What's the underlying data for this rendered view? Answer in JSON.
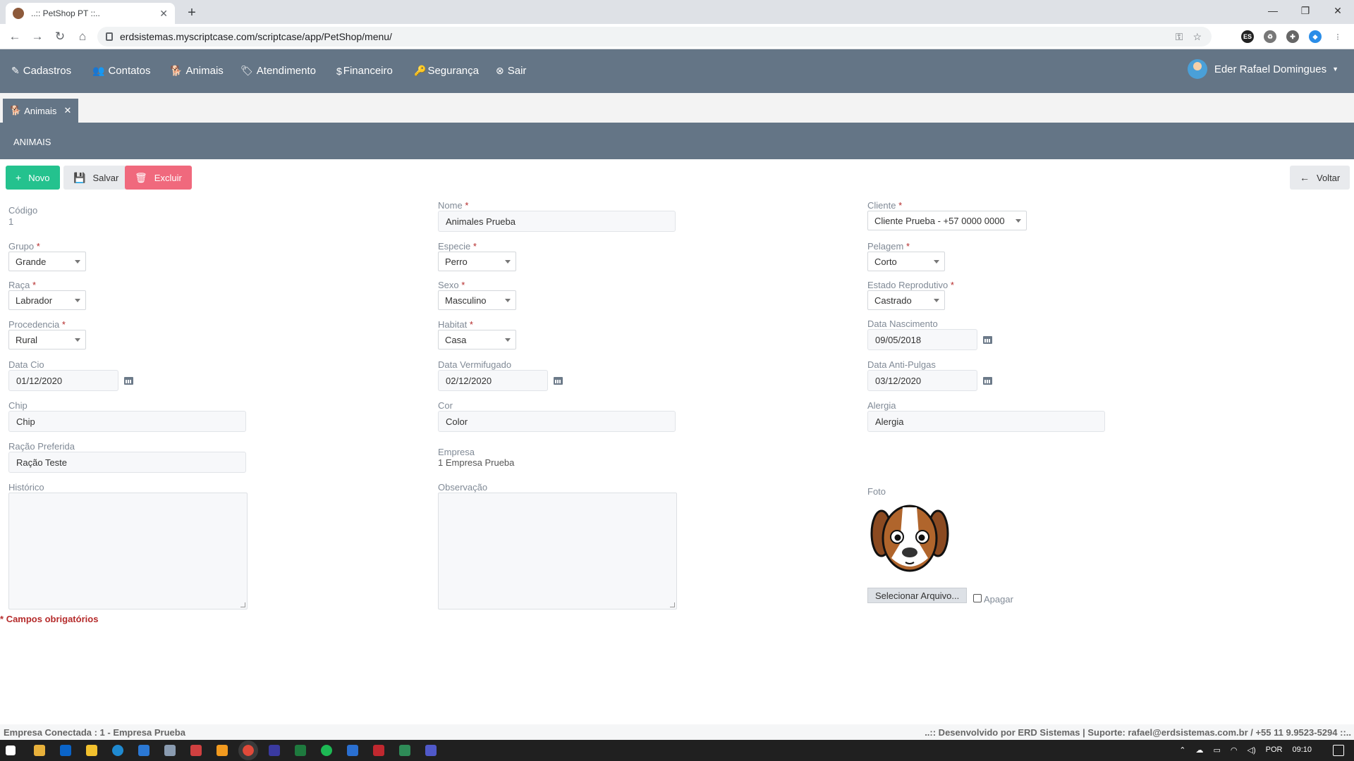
{
  "browser": {
    "tab_title": "..:: PetShop PT ::..",
    "url": "erdsistemas.myscriptcase.com/scriptcase/app/PetShop/menu/",
    "ext_label": "ES"
  },
  "menu": {
    "items": [
      {
        "label": "Cadastros",
        "icon": "edit-icon"
      },
      {
        "label": "Contatos",
        "icon": "users-icon"
      },
      {
        "label": "Animais",
        "icon": "dog-icon"
      },
      {
        "label": "Atendimento",
        "icon": "tags-icon"
      },
      {
        "label": "Financeiro",
        "icon": "dollar-icon"
      },
      {
        "label": "Segurança",
        "icon": "key-icon"
      },
      {
        "label": "Sair",
        "icon": "close-circle-icon"
      }
    ],
    "user_name": "Eder Rafael Domingues"
  },
  "app_tab": {
    "label": "Animais"
  },
  "page_title": "ANIMAIS",
  "actions": {
    "novo": "Novo",
    "salvar": "Salvar",
    "excluir": "Excluir",
    "voltar": "Voltar"
  },
  "form": {
    "codigo": {
      "label": "Código",
      "value": "1"
    },
    "nome": {
      "label": "Nome",
      "value": "Animales Prueba"
    },
    "cliente": {
      "label": "Cliente",
      "value": "Cliente Prueba - +57 0000 0000"
    },
    "grupo": {
      "label": "Grupo",
      "value": "Grande"
    },
    "especie": {
      "label": "Especie",
      "value": "Perro"
    },
    "pelagem": {
      "label": "Pelagem",
      "value": "Corto"
    },
    "raca": {
      "label": "Raça",
      "value": "Labrador"
    },
    "sexo": {
      "label": "Sexo",
      "value": "Masculino"
    },
    "estado_reprodutivo": {
      "label": "Estado Reprodutivo",
      "value": "Castrado"
    },
    "procedencia": {
      "label": "Procedencia",
      "value": "Rural"
    },
    "habitat": {
      "label": "Habitat",
      "value": "Casa"
    },
    "data_nascimento": {
      "label": "Data Nascimento",
      "value": "09/05/2018"
    },
    "data_cio": {
      "label": "Data Cio",
      "value": "01/12/2020"
    },
    "data_vermifugado": {
      "label": "Data Vermifugado",
      "value": "02/12/2020"
    },
    "data_anti_pulgas": {
      "label": "Data Anti-Pulgas",
      "value": "03/12/2020"
    },
    "chip": {
      "label": "Chip",
      "value": "Chip"
    },
    "cor": {
      "label": "Cor",
      "value": "Color"
    },
    "alergia": {
      "label": "Alergia",
      "value": "Alergia"
    },
    "racao_preferida": {
      "label": "Ração Preferida",
      "value": "Ração Teste"
    },
    "empresa": {
      "label": "Empresa",
      "value": "1 Empresa Prueba"
    },
    "historico": {
      "label": "Histórico",
      "value": ""
    },
    "observacao": {
      "label": "Observação",
      "value": ""
    },
    "foto": {
      "label": "Foto",
      "file_button": "Selecionar Arquivo...",
      "apagar_label": "Apagar"
    },
    "required_star": "*",
    "required_note": "Campos obrigatórios"
  },
  "footer": {
    "left": "Empresa Conectada : 1 - Empresa Prueba",
    "right": "..:: Desenvolvido por ERD Sistemas | Suporte: rafael@erdsistemas.com.br / +55 11 9.9523-5294 ::.."
  },
  "taskbar": {
    "lang": "POR",
    "time": "09:10"
  },
  "colors": {
    "header": "#647586",
    "novo": "#24c28e",
    "excluir": "#f0697d",
    "required": "#b52b2b"
  }
}
